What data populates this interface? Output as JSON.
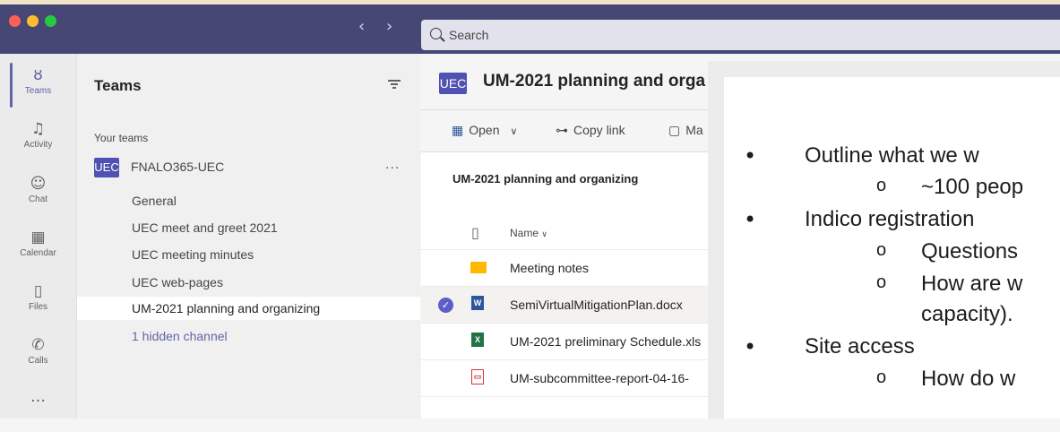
{
  "search": {
    "placeholder": "Search"
  },
  "nav": {
    "back": "‹",
    "forward": "›"
  },
  "rail": [
    {
      "label": "Teams",
      "icon": "teams-icon",
      "glyph": "ȣ"
    },
    {
      "label": "Activity",
      "icon": "bell-icon",
      "glyph": "♫"
    },
    {
      "label": "Chat",
      "icon": "chat-icon",
      "glyph": "☺"
    },
    {
      "label": "Calendar",
      "icon": "calendar-icon",
      "glyph": "▦"
    },
    {
      "label": "Files",
      "icon": "file-icon",
      "glyph": "▯"
    },
    {
      "label": "Calls",
      "icon": "phone-icon",
      "glyph": "✆"
    },
    {
      "label": "",
      "icon": "more-icon",
      "glyph": "…"
    }
  ],
  "teams_panel": {
    "title": "Teams",
    "section_label": "Your teams",
    "team": {
      "avatar": "UEC",
      "name": "FNALO365-UEC",
      "more": "..."
    },
    "channels": [
      "General",
      "UEC meet and greet 2021",
      "UEC meeting minutes",
      "UEC web-pages",
      "UM-2021 planning and organizing",
      "1 hidden channel"
    ]
  },
  "main": {
    "avatar": "UEC",
    "title": "UM-2021 planning and orga",
    "toolbar": {
      "open": "Open",
      "copy_link": "Copy link",
      "more": "Ma"
    },
    "library_title": "UM-2021 planning and organizing",
    "column_name": "Name",
    "files": [
      {
        "name": "Meeting notes",
        "type": "folder"
      },
      {
        "name": "SemiVirtualMitigationPlan.docx",
        "type": "word",
        "selected": true
      },
      {
        "name": "UM-2021 preliminary Schedule.xls",
        "type": "excel"
      },
      {
        "name": "UM-subcommittee-report-04-16-",
        "type": "pdf"
      }
    ]
  },
  "document": {
    "lines": [
      "Outline what we w",
      "~100 peop",
      "Indico registration",
      "Questions",
      "How are w",
      "capacity).",
      "Site access",
      "How do w"
    ]
  },
  "colors": {
    "titlebar": "#464775",
    "accent": "#6264a7",
    "team_avatar": "#4f52b2"
  }
}
